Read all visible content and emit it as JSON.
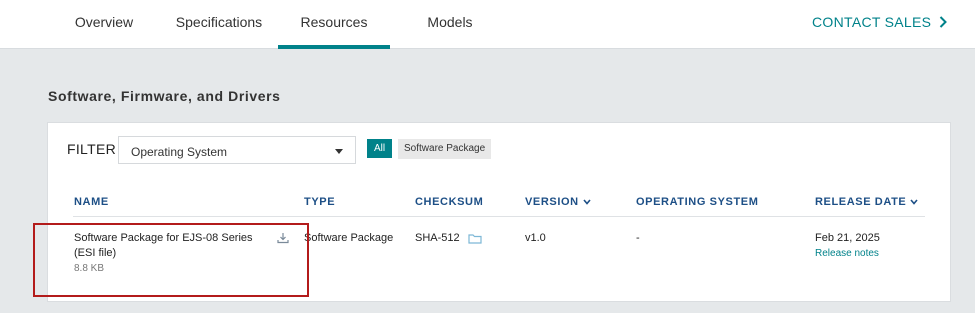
{
  "nav": {
    "tabs": [
      {
        "label": "Overview"
      },
      {
        "label": "Specifications"
      },
      {
        "label": "Resources"
      },
      {
        "label": "Models"
      }
    ],
    "contact_label": "CONTACT SALES",
    "accent_color": "#00828a"
  },
  "section_title": "Software, Firmware, and Drivers",
  "filter": {
    "label": "FILTER",
    "select_value": "Operating System",
    "chips": {
      "all": "All",
      "package": "Software Package"
    }
  },
  "table": {
    "headers": {
      "name": "NAME",
      "type": "TYPE",
      "checksum": "CHECKSUM",
      "version": "VERSION",
      "os": "OPERATING SYSTEM",
      "release_date": "RELEASE DATE"
    },
    "rows": [
      {
        "name": "Software Package for EJS-08 Series (ESI file)",
        "size": "8.8 KB",
        "type": "Software Package",
        "checksum": "SHA-512",
        "version": "v1.0",
        "os": "-",
        "release_date": "Feb 21, 2025",
        "release_notes": "Release notes"
      }
    ]
  },
  "icons": {
    "download": "download-icon",
    "folder": "folder-icon",
    "chevron_right": "chevron-right-icon",
    "chevron_down": "chevron-down-icon",
    "caret": "caret-down-icon"
  },
  "highlight_color": "#b31b1b"
}
